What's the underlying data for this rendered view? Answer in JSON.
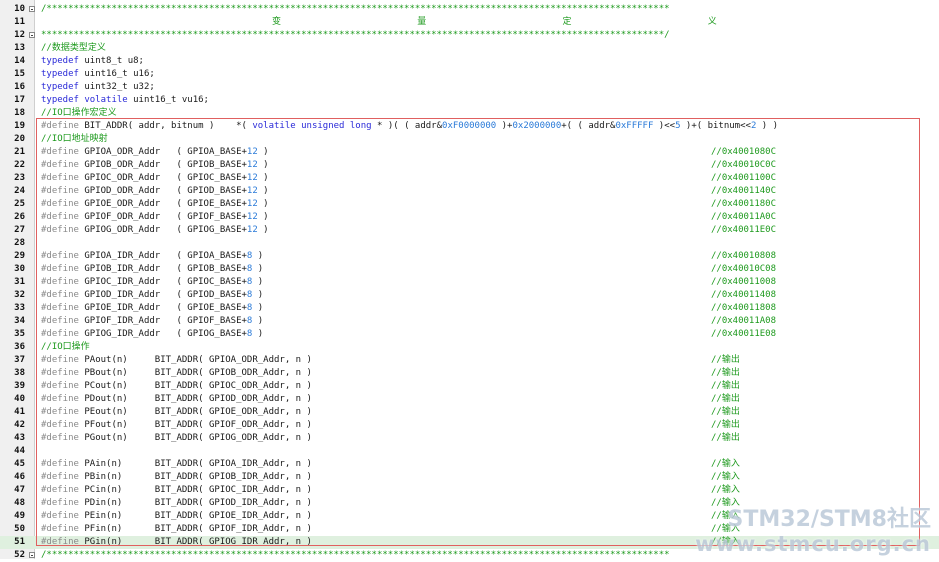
{
  "lines": [
    {
      "n": "10",
      "fold": true,
      "code": "/*******************************************************************************************************************"
    },
    {
      "n": "11",
      "center": "变   量   定   义"
    },
    {
      "n": "12",
      "fold": true,
      "code": "*******************************************************************************************************************/"
    },
    {
      "n": "13",
      "code": "//数据类型定义",
      "style": "green"
    },
    {
      "n": "14",
      "kw": "typedef",
      "code": " uint8_t u8;"
    },
    {
      "n": "15",
      "kw": "typedef",
      "code": " uint16_t u16;"
    },
    {
      "n": "16",
      "kw": "typedef",
      "code": " uint32_t u32;"
    },
    {
      "n": "17",
      "kw": "typedef volatile",
      "code": " uint16_t vu16;"
    },
    {
      "n": "18",
      "code": "//IO口操作宏定义",
      "style": "green"
    },
    {
      "n": "19",
      "pp": "#define",
      "code": " BIT_ADDR( addr, bitnum )    *( volatile unsigned long * )( ( addr&0xF0000000 )+0x2000000+( ( addr&0xFFFFF )<<5 )+( bitnum<<2 ) )"
    },
    {
      "n": "20",
      "code": "//IO口地址映射",
      "style": "green"
    },
    {
      "n": "21",
      "pp": "#define",
      "code": " GPIOA_ODR_Addr   ( GPIOA_BASE+12 )",
      "cmt": "//0x4001080C"
    },
    {
      "n": "22",
      "pp": "#define",
      "code": " GPIOB_ODR_Addr   ( GPIOB_BASE+12 )",
      "cmt": "//0x40010C0C"
    },
    {
      "n": "23",
      "pp": "#define",
      "code": " GPIOC_ODR_Addr   ( GPIOC_BASE+12 )",
      "cmt": "//0x4001100C"
    },
    {
      "n": "24",
      "pp": "#define",
      "code": " GPIOD_ODR_Addr   ( GPIOD_BASE+12 )",
      "cmt": "//0x4001140C"
    },
    {
      "n": "25",
      "pp": "#define",
      "code": " GPIOE_ODR_Addr   ( GPIOE_BASE+12 )",
      "cmt": "//0x4001180C"
    },
    {
      "n": "26",
      "pp": "#define",
      "code": " GPIOF_ODR_Addr   ( GPIOF_BASE+12 )",
      "cmt": "//0x40011A0C"
    },
    {
      "n": "27",
      "pp": "#define",
      "code": " GPIOG_ODR_Addr   ( GPIOG_BASE+12 )",
      "cmt": "//0x40011E0C"
    },
    {
      "n": "28",
      "code": ""
    },
    {
      "n": "29",
      "pp": "#define",
      "code": " GPIOA_IDR_Addr   ( GPIOA_BASE+8 )",
      "cmt": "//0x40010808"
    },
    {
      "n": "30",
      "pp": "#define",
      "code": " GPIOB_IDR_Addr   ( GPIOB_BASE+8 )",
      "cmt": "//0x40010C08"
    },
    {
      "n": "31",
      "pp": "#define",
      "code": " GPIOC_IDR_Addr   ( GPIOC_BASE+8 )",
      "cmt": "//0x40011008"
    },
    {
      "n": "32",
      "pp": "#define",
      "code": " GPIOD_IDR_Addr   ( GPIOD_BASE+8 )",
      "cmt": "//0x40011408"
    },
    {
      "n": "33",
      "pp": "#define",
      "code": " GPIOE_IDR_Addr   ( GPIOE_BASE+8 )",
      "cmt": "//0x40011808"
    },
    {
      "n": "34",
      "pp": "#define",
      "code": " GPIOF_IDR_Addr   ( GPIOF_BASE+8 )",
      "cmt": "//0x40011A08"
    },
    {
      "n": "35",
      "pp": "#define",
      "code": " GPIOG_IDR_Addr   ( GPIOG_BASE+8 )",
      "cmt": "//0x40011E08"
    },
    {
      "n": "36",
      "code": "//IO口操作",
      "style": "green"
    },
    {
      "n": "37",
      "pp": "#define",
      "code": " PAout(n)     BIT_ADDR( GPIOA_ODR_Addr, n )",
      "cmt": "//输出"
    },
    {
      "n": "38",
      "pp": "#define",
      "code": " PBout(n)     BIT_ADDR( GPIOB_ODR_Addr, n )",
      "cmt": "//输出"
    },
    {
      "n": "39",
      "pp": "#define",
      "code": " PCout(n)     BIT_ADDR( GPIOC_ODR_Addr, n )",
      "cmt": "//输出"
    },
    {
      "n": "40",
      "pp": "#define",
      "code": " PDout(n)     BIT_ADDR( GPIOD_ODR_Addr, n )",
      "cmt": "//输出"
    },
    {
      "n": "41",
      "pp": "#define",
      "code": " PEout(n)     BIT_ADDR( GPIOE_ODR_Addr, n )",
      "cmt": "//输出"
    },
    {
      "n": "42",
      "pp": "#define",
      "code": " PFout(n)     BIT_ADDR( GPIOF_ODR_Addr, n )",
      "cmt": "//输出"
    },
    {
      "n": "43",
      "pp": "#define",
      "code": " PGout(n)     BIT_ADDR( GPIOG_ODR_Addr, n )",
      "cmt": "//输出"
    },
    {
      "n": "44",
      "code": ""
    },
    {
      "n": "45",
      "pp": "#define",
      "code": " PAin(n)      BIT_ADDR( GPIOA_IDR_Addr, n )",
      "cmt": "//输入"
    },
    {
      "n": "46",
      "pp": "#define",
      "code": " PBin(n)      BIT_ADDR( GPIOB_IDR_Addr, n )",
      "cmt": "//输入"
    },
    {
      "n": "47",
      "pp": "#define",
      "code": " PCin(n)      BIT_ADDR( GPIOC_IDR_Addr, n )",
      "cmt": "//输入"
    },
    {
      "n": "48",
      "pp": "#define",
      "code": " PDin(n)      BIT_ADDR( GPIOD_IDR_Addr, n )",
      "cmt": "//输入"
    },
    {
      "n": "49",
      "pp": "#define",
      "code": " PEin(n)      BIT_ADDR( GPIOE_IDR_Addr, n )",
      "cmt": "//输入"
    },
    {
      "n": "50",
      "pp": "#define",
      "code": " PFin(n)      BIT_ADDR( GPIOF_IDR_Addr, n )",
      "cmt": "//输入"
    },
    {
      "n": "51",
      "pp": "#define",
      "code": " PGin(n)      BIT_ADDR( GPIOG_IDR_Addr, n )",
      "cmt": "//输入",
      "highlight": true
    },
    {
      "n": "52",
      "fold": true,
      "code": "/*******************************************************************************************************************"
    }
  ],
  "watermark": {
    "line1": "STM32/STM8社区",
    "line2": "www.stmcu.org.cn"
  },
  "colors": {
    "keyword": "#2a2ad8",
    "preprocessor": "#8a8a8a",
    "comment": "#1e9a1e",
    "selection_border": "#e06060",
    "current_line": "#dff0df"
  }
}
